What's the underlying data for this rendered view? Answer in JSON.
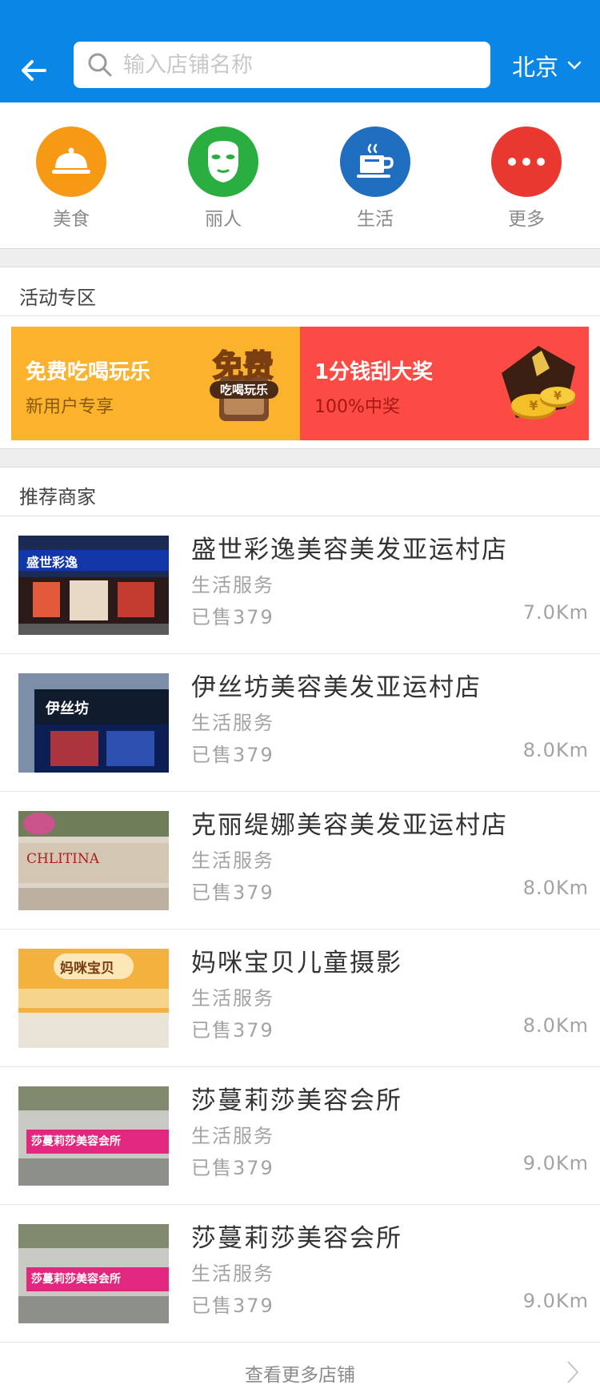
{
  "header": {
    "search_placeholder": "输入店铺名称",
    "city": "北京",
    "bg_color": "#0a87e6"
  },
  "categories": [
    {
      "label": "美食",
      "icon": "food-cloche-icon",
      "color": "#f59a12"
    },
    {
      "label": "丽人",
      "icon": "face-mask-icon",
      "color": "#2aae3f"
    },
    {
      "label": "生活",
      "icon": "coffee-cup-icon",
      "color": "#1f6ec0"
    },
    {
      "label": "更多",
      "icon": "more-dots-icon",
      "color": "#e8382f"
    }
  ],
  "activity": {
    "title": "活动专区",
    "promos": [
      {
        "title": "免费吃喝玩乐",
        "subtitle": "新用户专享",
        "badge": "免费",
        "badge_sub": "吃喝玩乐",
        "color": "#fbb22d"
      },
      {
        "title": "1分钱刮大奖",
        "subtitle": "100%中奖",
        "color": "#fc4b45"
      }
    ]
  },
  "recommend": {
    "title": "推荐商家",
    "shops": [
      {
        "name": "盛世彩逸美容美发亚运村店",
        "type": "生活服务",
        "sold": "已售379",
        "distance": "7.0Km",
        "sign": "盛世彩逸"
      },
      {
        "name": "伊丝坊美容美发亚运村店",
        "type": "生活服务",
        "sold": "已售379",
        "distance": "8.0Km",
        "sign": "伊丝坊"
      },
      {
        "name": "克丽缇娜美容美发亚运村店",
        "type": "生活服务",
        "sold": "已售379",
        "distance": "8.0Km",
        "sign": "CHLITINA"
      },
      {
        "name": "妈咪宝贝儿童摄影",
        "type": "生活服务",
        "sold": "已售379",
        "distance": "8.0Km",
        "sign": "妈咪宝贝"
      },
      {
        "name": "莎蔓莉莎美容会所",
        "type": "生活服务",
        "sold": "已售379",
        "distance": "9.0Km",
        "sign": "莎蔓莉莎美容会所"
      },
      {
        "name": "莎蔓莉莎美容会所",
        "type": "生活服务",
        "sold": "已售379",
        "distance": "9.0Km",
        "sign": "莎蔓莉莎美容会所"
      }
    ],
    "more_label": "查看更多店铺"
  }
}
